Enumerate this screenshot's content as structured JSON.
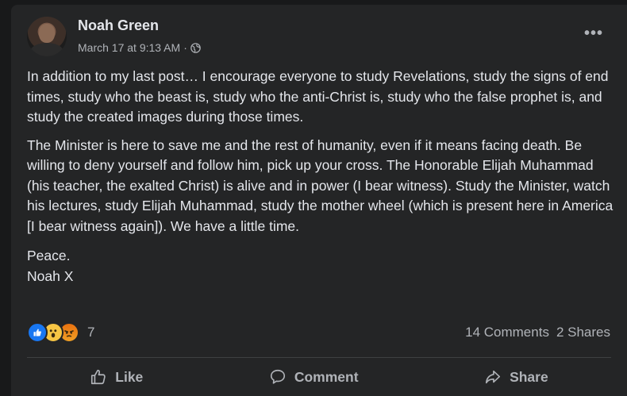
{
  "post": {
    "author": "Noah Green",
    "timestamp": "March 17 at 9:13 AM",
    "separator": " · ",
    "audience_icon": "globe-icon",
    "more_icon": "more-options-icon",
    "more_label": "•••",
    "paragraphs": [
      "In addition to my last post… I encourage everyone to study Revelations, study the signs of end times, study who the beast is, study who the anti-Christ is, study who the false prophet is, and study the created images during those times.",
      "The Minister is here to save me and the rest of humanity, even if it means facing death. Be willing to deny yourself and follow him, pick up your cross. The Honorable Elijah Muhammad (his teacher, the exalted Christ) is alive and in power (I bear witness). Study the Minister, watch his lectures, study Elijah Muhammad, study the mother wheel (which is present here in America [I bear witness again]). We have a little time."
    ],
    "signoff_line1": "Peace.",
    "signoff_line2": "Noah X"
  },
  "reactions": {
    "icons": [
      "like-reaction-icon",
      "wow-reaction-icon",
      "angry-reaction-icon"
    ],
    "count": "7"
  },
  "stats": {
    "comments": "14 Comments",
    "shares": "2 Shares"
  },
  "actions": {
    "like": "Like",
    "comment": "Comment",
    "share": "Share"
  },
  "colors": {
    "background": "#242526",
    "text": "#e4e6eb",
    "secondary_text": "#b0b3b8",
    "like_blue": "#1877f2"
  }
}
